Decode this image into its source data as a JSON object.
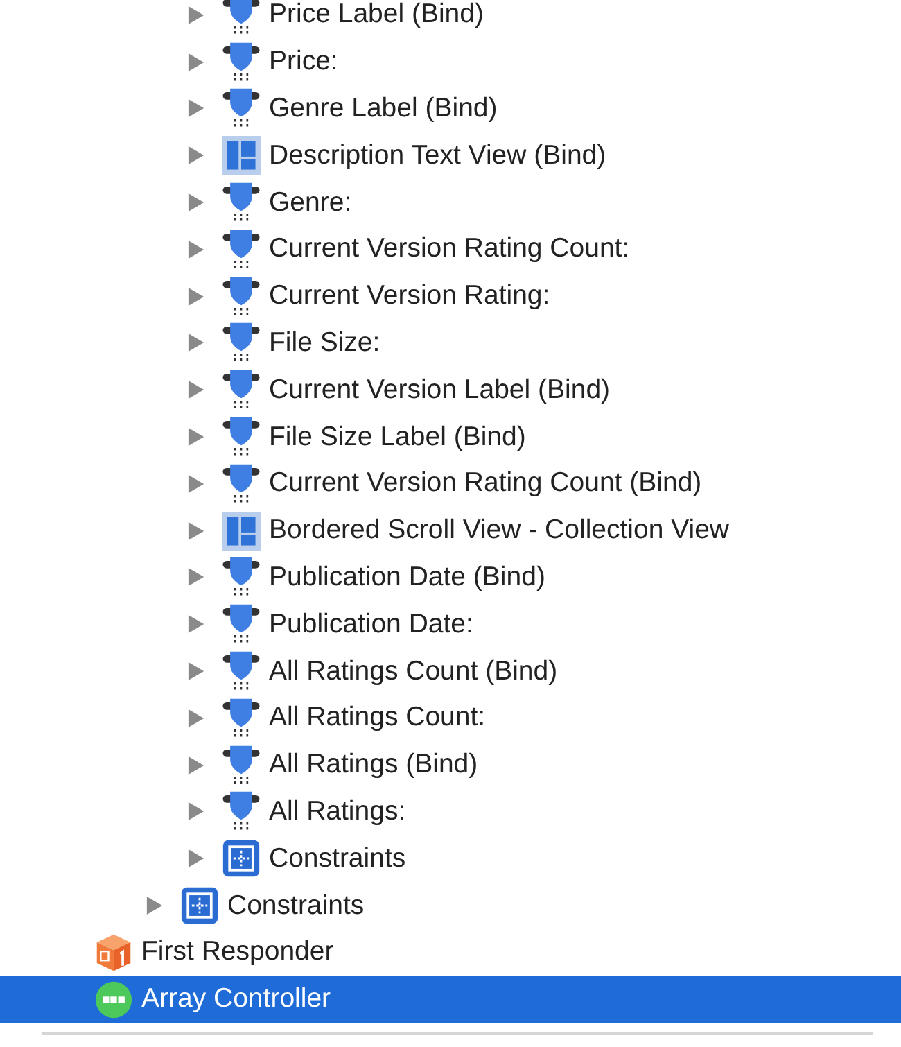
{
  "tree": [
    {
      "children": [
        {
          "children": [
            {
              "label": "Price Label (Bind)",
              "kind": "binding",
              "expanded": false,
              "selected": false
            },
            {
              "label": "Price:",
              "kind": "binding",
              "expanded": false,
              "selected": false
            },
            {
              "label": "Genre Label (Bind)",
              "kind": "binding",
              "expanded": false,
              "selected": false
            },
            {
              "label": "Description Text View (Bind)",
              "kind": "view",
              "expanded": false,
              "selected": false
            },
            {
              "label": "Genre:",
              "kind": "binding",
              "expanded": false,
              "selected": false
            },
            {
              "label": "Current Version Rating Count:",
              "kind": "binding",
              "expanded": false,
              "selected": false
            },
            {
              "label": "Current Version Rating:",
              "kind": "binding",
              "expanded": false,
              "selected": false
            },
            {
              "label": "File Size:",
              "kind": "binding",
              "expanded": false,
              "selected": false
            },
            {
              "label": "Current Version Label (Bind)",
              "kind": "binding",
              "expanded": false,
              "selected": false
            },
            {
              "label": "File Size Label (Bind)",
              "kind": "binding",
              "expanded": false,
              "selected": false
            },
            {
              "label": "Current Version Rating Count (Bind)",
              "kind": "binding",
              "expanded": false,
              "selected": false
            },
            {
              "label": "Bordered Scroll View - Collection View",
              "kind": "view",
              "expanded": false,
              "selected": false
            },
            {
              "label": "Publication Date (Bind)",
              "kind": "binding",
              "expanded": false,
              "selected": false
            },
            {
              "label": "Publication Date:",
              "kind": "binding",
              "expanded": false,
              "selected": false
            },
            {
              "label": "All Ratings Count (Bind)",
              "kind": "binding",
              "expanded": false,
              "selected": false
            },
            {
              "label": "All Ratings Count:",
              "kind": "binding",
              "expanded": false,
              "selected": false
            },
            {
              "label": "All Ratings (Bind)",
              "kind": "binding",
              "expanded": false,
              "selected": false
            },
            {
              "label": "All Ratings:",
              "kind": "binding",
              "expanded": false,
              "selected": false
            },
            {
              "label": "Constraints",
              "kind": "constraints",
              "expanded": false,
              "selected": false
            }
          ]
        },
        {
          "label": "Constraints",
          "kind": "constraints",
          "expanded": false,
          "selected": false
        }
      ]
    },
    {
      "label": "First Responder",
      "kind": "responder",
      "selected": false
    },
    {
      "label": "Array Controller",
      "kind": "controller",
      "selected": true
    }
  ]
}
